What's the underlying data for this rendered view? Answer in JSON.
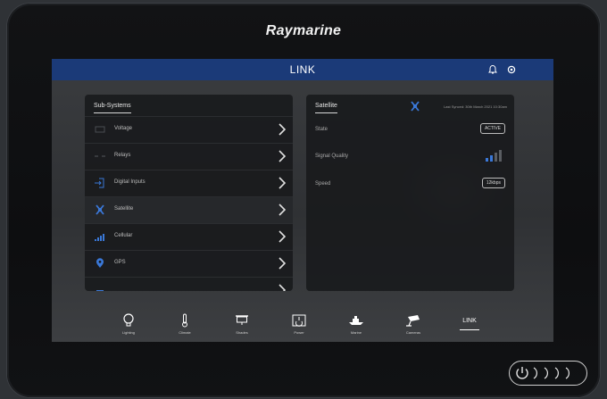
{
  "brand": "Raymarine",
  "header": {
    "title": "LINK",
    "icons": [
      "bell-icon",
      "gear-icon"
    ]
  },
  "subsystems": {
    "title": "Sub-Systems",
    "items": [
      {
        "label": "Voltage",
        "icon": "battery-icon"
      },
      {
        "label": "Relays",
        "icon": "relay-icon"
      },
      {
        "label": "Digital Inputs",
        "icon": "digital-input-icon"
      },
      {
        "label": "Satellite",
        "icon": "satellite-icon",
        "active": true
      },
      {
        "label": "Cellular",
        "icon": "cellular-icon"
      },
      {
        "label": "GPS",
        "icon": "gps-pin-icon"
      }
    ]
  },
  "satellite": {
    "title": "Satellite",
    "last_synced": "Last Synced: 30th March 2021 10:30am",
    "state_label": "State",
    "state_value": "ACTIVE",
    "signal_label": "Signal Quality",
    "signal_bars": 2,
    "signal_bars_total": 4,
    "speed_label": "Speed",
    "speed_value": "12kbps"
  },
  "nav": {
    "items": [
      {
        "label": "Lighting",
        "icon": "lightbulb-icon"
      },
      {
        "label": "Climate",
        "icon": "thermometer-icon"
      },
      {
        "label": "Shades",
        "icon": "shades-icon"
      },
      {
        "label": "Power",
        "icon": "power-panel-icon"
      },
      {
        "label": "Marine",
        "icon": "boat-icon"
      },
      {
        "label": "Cameras",
        "icon": "camera-icon"
      },
      {
        "label": "LINK",
        "icon": "",
        "active": true
      }
    ]
  },
  "colors": {
    "title_bar": "#1b3a78",
    "accent_blue": "#3a78d8"
  },
  "hardware": {
    "icons": [
      "power-icon"
    ]
  }
}
